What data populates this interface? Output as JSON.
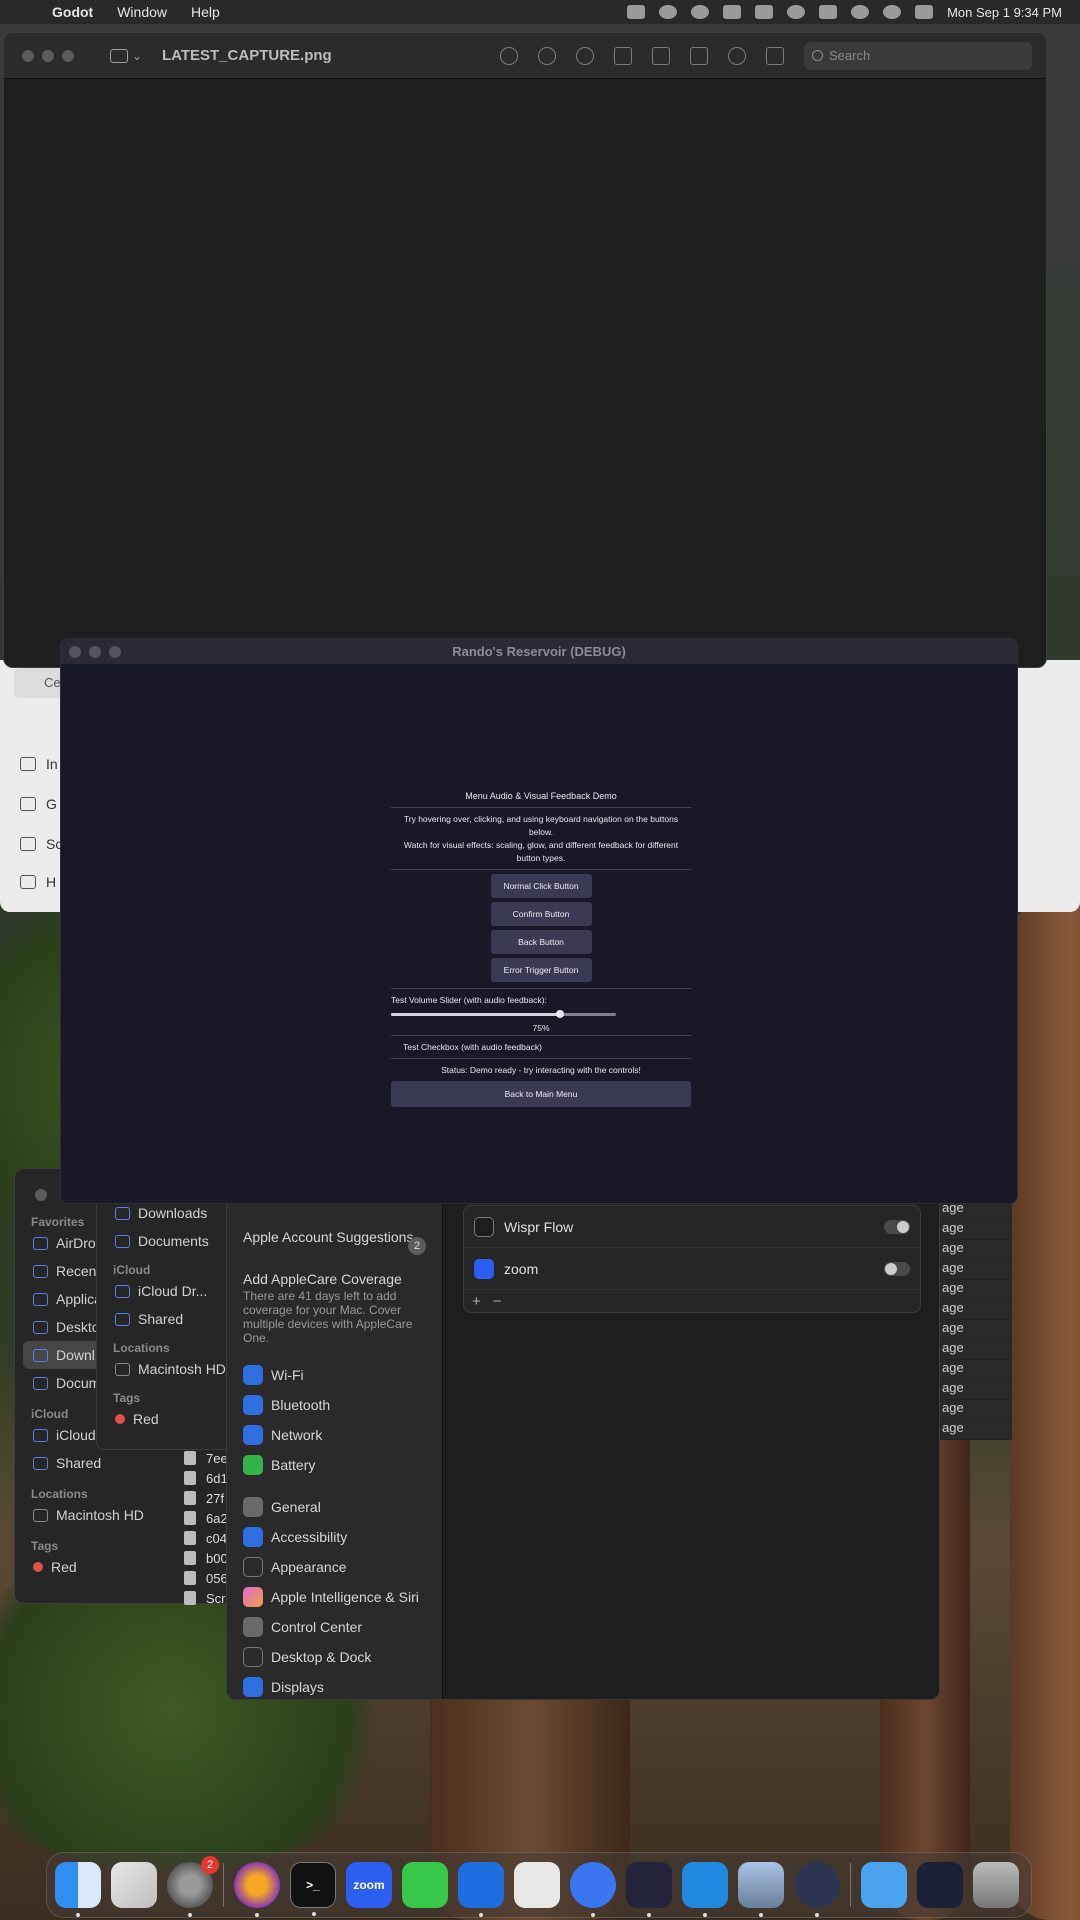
{
  "menubar": {
    "app": "Godot",
    "items": [
      "Window",
      "Help"
    ],
    "clock": "Mon Sep 1  9:34 PM"
  },
  "preview": {
    "filename": "LATEST_CAPTURE.png",
    "search_placeholder": "Search"
  },
  "back_window": {
    "button_label": "Ce",
    "rows": [
      "In",
      "G",
      "Sc",
      "H"
    ]
  },
  "finder": {
    "favorites_label": "Favorites",
    "favorites": [
      "AirDrop",
      "Recent",
      "Applica",
      "Deskto",
      "Downl",
      "Docum"
    ],
    "icloud_label": "iCloud",
    "icloud": [
      "iCloud Dr...",
      "Shared"
    ],
    "locations_label": "Locations",
    "locations": [
      "Macintosh HD"
    ],
    "tags_label": "Tags",
    "tags": [
      "Red"
    ],
    "files": [
      "7ee",
      "6d1",
      "27f",
      "6a2",
      "c04",
      "b00",
      "056",
      "Scr"
    ]
  },
  "finder2": {
    "favorites": [
      "Downloads",
      "Documents"
    ],
    "icloud_label": "iCloud",
    "icloud": [
      "iCloud Dr...",
      "Shared"
    ],
    "locations_label": "Locations",
    "locations": [
      "Macintosh HD"
    ],
    "tags_label": "Tags",
    "tags": [
      "Red"
    ]
  },
  "settings": {
    "account_suggestions": "Apple Account Suggestions",
    "account_badge": "2",
    "applecare_title": "Add AppleCare Coverage",
    "applecare_text": "There are 41 days left to add coverage for your Mac. Cover multiple devices with AppleCare One.",
    "items": [
      "Wi-Fi",
      "Bluetooth",
      "Network",
      "Battery",
      "General",
      "Accessibility",
      "Appearance",
      "Apple Intelligence & Siri",
      "Control Center",
      "Desktop & Dock",
      "Displays"
    ],
    "apps": [
      {
        "name": "Wispr Flow",
        "enabled": true
      },
      {
        "name": "zoom",
        "enabled": false
      }
    ],
    "add_label": "+",
    "remove_label": "−"
  },
  "right_strip": [
    "age",
    "age",
    "age",
    "age",
    "age",
    "age",
    "age",
    "age",
    "age",
    "age",
    "age",
    "age"
  ],
  "game": {
    "window_title": "Rando's Reservoir (DEBUG)",
    "panel_title": "Menu Audio & Visual Feedback Demo",
    "desc1": "Try hovering over, clicking, and using keyboard navigation on the buttons below.",
    "desc2": "Watch for visual effects: scaling, glow, and different feedback for different button types.",
    "buttons": [
      "Normal Click Button",
      "Confirm Button",
      "Back Button",
      "Error Trigger Button"
    ],
    "slider_label": "Test Volume Slider (with audio feedback):",
    "slider_value": 0.75,
    "slider_pct": "75%",
    "checkbox_label": "Test Checkbox (with audio feedback)",
    "status": "Status: Demo ready - try interacting with the controls!",
    "back_main": "Back to Main Menu"
  },
  "dock": {
    "settings_badge": "2",
    "zoom_label": "zoom",
    "terminal_label": ">_"
  }
}
